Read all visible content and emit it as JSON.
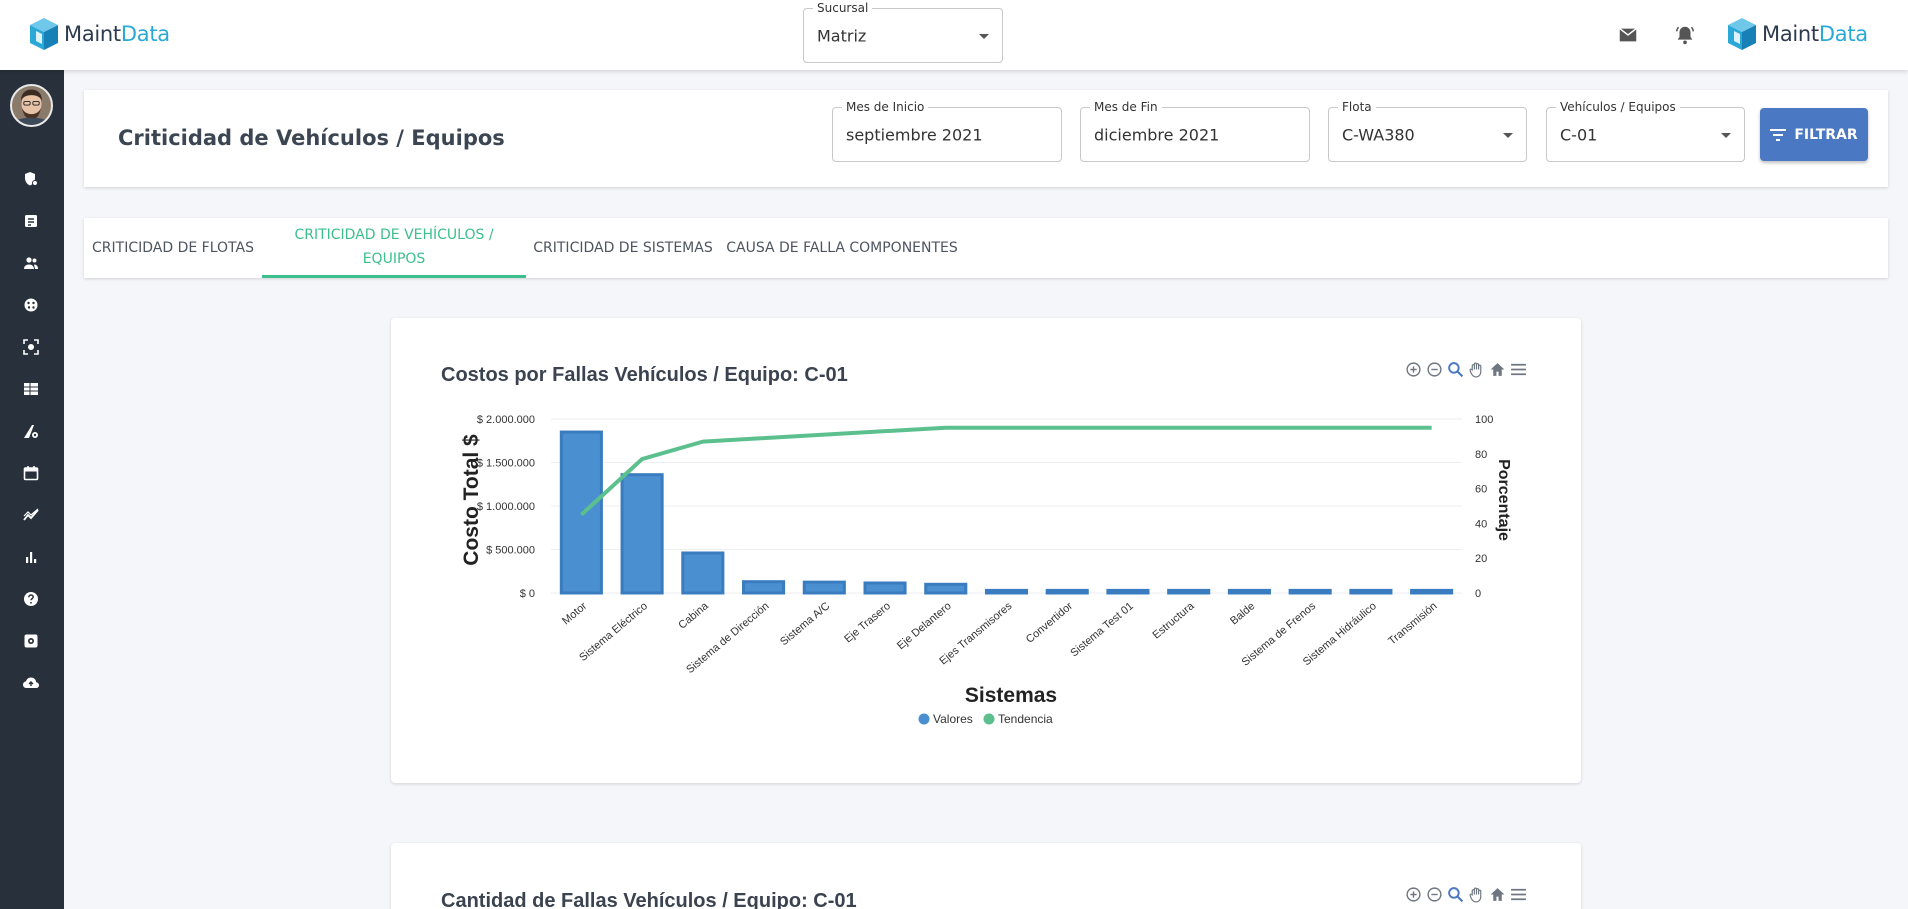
{
  "brand": {
    "name_part1": "Maint",
    "name_part2": "Data",
    "accent": "#2aa9d8"
  },
  "header": {
    "branch_label": "Sucursal",
    "branch_value": "Matriz",
    "icons": [
      "mail-icon",
      "bell-alert-icon"
    ]
  },
  "sidebar": {
    "items": [
      "shield-gear-icon",
      "receipt-icon",
      "people-icon",
      "palette-icon",
      "scan-icon",
      "table-icon",
      "road-gear-icon",
      "calendar-icon",
      "trend-icon",
      "bar-chart-icon",
      "help-icon",
      "settings-box-icon",
      "cloud-upload-icon"
    ]
  },
  "filters": {
    "page_title": "Criticidad de Vehículos / Equipos",
    "start_label": "Mes de Inicio",
    "start_value": "septiembre 2021",
    "end_label": "Mes de Fin",
    "end_value": "diciembre 2021",
    "fleet_label": "Flota",
    "fleet_value": "C-WA380",
    "vehicle_label": "Vehículos / Equipos",
    "vehicle_value": "C-01",
    "filter_button": "FILTRAR"
  },
  "tabs": [
    {
      "label": "CRITICIDAD DE FLOTAS"
    },
    {
      "label": "CRITICIDAD DE VEHÍCULOS / EQUIPOS"
    },
    {
      "label": "CRITICIDAD DE SISTEMAS"
    },
    {
      "label": "CAUSA DE FALLA COMPONENTES"
    }
  ],
  "second_chart_title": "Cantidad de Fallas Vehículos / Equipo: C-01",
  "colors": {
    "bar": "#4a8fd0",
    "bar_border": "#3a7cc0",
    "trend": "#5cc08e",
    "tab_active": "#3cbf8c"
  },
  "chart_data": {
    "type": "bar",
    "title": "Costos por Fallas Vehículos / Equipo: C-01",
    "xlabel": "Sistemas",
    "ylabel": "Costo Total $",
    "y2label": "Porcentaje",
    "categories": [
      "Motor",
      "Sistema Eléctrico",
      "Cabina",
      "Sistema de Dirección",
      "Sistema A/C",
      "Eje Trasero",
      "Eje Delantero",
      "Ejes Transmisores",
      "Convertidor",
      "Sistema Test 01",
      "Estructura",
      "Balde",
      "Sistema de Frenos",
      "Sistema Hidráulico",
      "Transmisión"
    ],
    "y_ticks": [
      "$ 0",
      "$ 500.000",
      "$ 1.000.000",
      "$ 1.500.000",
      "$ 2.000.000"
    ],
    "y2_ticks": [
      "0",
      "20",
      "40",
      "60",
      "80",
      "100"
    ],
    "ylim": [
      0,
      2000000
    ],
    "y2lim": [
      0,
      100
    ],
    "series": [
      {
        "name": "Valores",
        "type": "bar",
        "values": [
          1850000,
          1360000,
          460000,
          130000,
          125000,
          115000,
          100000,
          30000,
          30000,
          30000,
          30000,
          30000,
          30000,
          30000,
          30000
        ]
      },
      {
        "name": "Tendencia",
        "type": "line",
        "axis": "right",
        "values": [
          45,
          77,
          87,
          89,
          91,
          93,
          95,
          95,
          95,
          95,
          95,
          95,
          95,
          95,
          95
        ]
      }
    ],
    "legend_position": "bottom-center",
    "grid": true
  }
}
